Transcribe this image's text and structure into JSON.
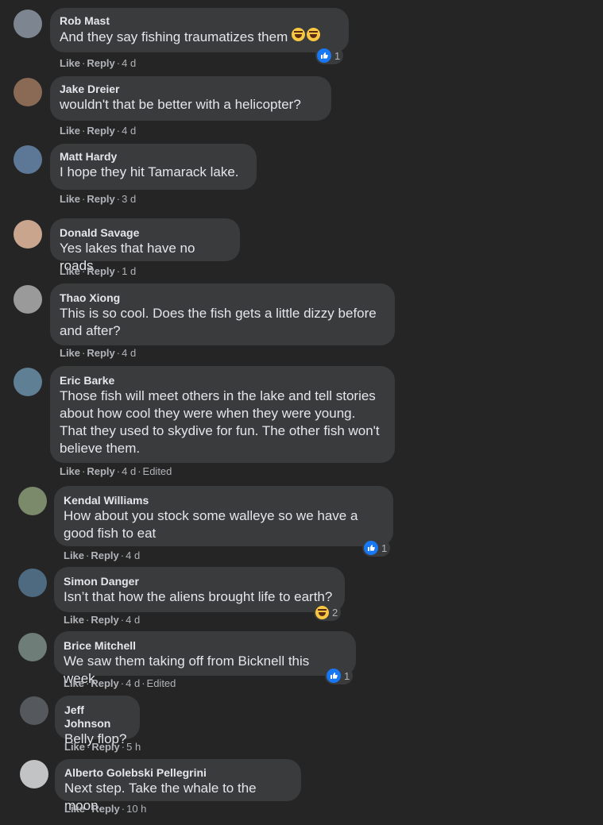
{
  "comments": [
    {
      "name": "Rob Mast",
      "text": "And they say fishing traumatizes them",
      "like": "Like",
      "reply": "Reply",
      "time": "4 d",
      "edited": "",
      "reaction_count": "1"
    },
    {
      "name": "Jake Dreier",
      "text": "wouldn't that be better with a helicopter?",
      "like": "Like",
      "reply": "Reply",
      "time": "4 d"
    },
    {
      "name": "Matt Hardy",
      "text": "I hope they hit Tamarack lake.",
      "like": "Like",
      "reply": "Reply",
      "time": "3 d"
    },
    {
      "name": "Donald Savage",
      "text": "Yes lakes that have no roads",
      "like": "Like",
      "reply": "Reply",
      "time": "1 d"
    },
    {
      "name": "Thao Xiong",
      "text": "This is so cool. Does the fish gets a little dizzy before and after?",
      "like": "Like",
      "reply": "Reply",
      "time": "4 d"
    },
    {
      "name": "Eric Barke",
      "text": "Those fish will meet others in the lake and tell stories about how cool they were when they were young. That they used to skydive for fun. The other fish won't believe them.",
      "like": "Like",
      "reply": "Reply",
      "time": "4 d",
      "edited": "Edited"
    },
    {
      "name": "Kendal Williams",
      "text": "How about you stock some walleye so we have a good fish to eat",
      "like": "Like",
      "reply": "Reply",
      "time": "4 d",
      "reaction_count": "1"
    },
    {
      "name": "Simon Danger",
      "text": "Isn’t that how the aliens brought life to earth?",
      "like": "Like",
      "reply": "Reply",
      "time": "4 d",
      "reaction_count": "2"
    },
    {
      "name": "Brice Mitchell",
      "text": "We saw them taking off from Bicknell this week.",
      "like": "Like",
      "reply": "Reply",
      "time": "4 d",
      "edited": "Edited",
      "reaction_count": "1"
    },
    {
      "name": "Jeff Johnson",
      "text": "Belly flop?",
      "like": "Like",
      "reply": "Reply",
      "time": "5 h"
    },
    {
      "name": "Alberto Golebski Pellegrini",
      "text": "Next step. Take the whale to the moon.",
      "like": "Like",
      "reply": "Reply",
      "time": "10 h"
    }
  ],
  "colors": {
    "background": "#252526",
    "bubble": "#3a3b3c",
    "like_blue": "#1877f2",
    "haha_yellow": "#f7c744"
  },
  "icons": {
    "like": "thumbs-up-icon",
    "haha": "haha-emoji-icon"
  }
}
